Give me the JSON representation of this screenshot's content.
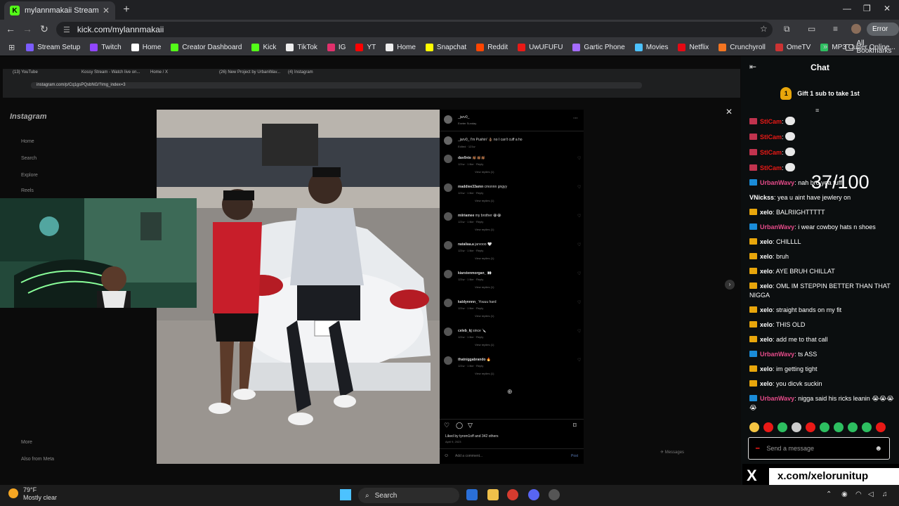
{
  "browser": {
    "tab_title": "mylannmakaii Stream - Watch l",
    "new_tab": "+",
    "url": "kick.com/mylannmakaii",
    "error_label": "Error",
    "bookmarks": [
      {
        "label": "Stream Setup",
        "color": "#7b5cff"
      },
      {
        "label": "Twitch",
        "color": "#9146ff"
      },
      {
        "label": "Home",
        "color": "#ffffff"
      },
      {
        "label": "Creator Dashboard",
        "color": "#53fc18"
      },
      {
        "label": "Kick",
        "color": "#53fc18"
      },
      {
        "label": "TikTok",
        "color": "#eeeeee"
      },
      {
        "label": "IG",
        "color": "#e1306c"
      },
      {
        "label": "YT",
        "color": "#ff0000"
      },
      {
        "label": "Home",
        "color": "#eeeeee"
      },
      {
        "label": "Snapchat",
        "color": "#fffc00"
      },
      {
        "label": "Reddit",
        "color": "#ff4500"
      },
      {
        "label": "UwUFUFU",
        "color": "#e91916"
      },
      {
        "label": "Gartic Phone",
        "color": "#a56cff"
      },
      {
        "label": "Movies",
        "color": "#4cc2ff"
      },
      {
        "label": "Netflix",
        "color": "#e50914"
      },
      {
        "label": "Crunchyroll",
        "color": "#f47521"
      },
      {
        "label": "OmeTV",
        "color": "#cc3333"
      },
      {
        "label": "MP3 Cutter Online...",
        "color": "#2dbe60"
      }
    ],
    "all_bookmarks": "All Bookmarks"
  },
  "stream": {
    "inner_tabs": [
      "(13) YouTube",
      "Kossy Stream - Watch live on...",
      "Home / X",
      "(26) New Project by UrbanWav...",
      "(4) Instagram"
    ],
    "inner_url": "instagram.com/p/Cq1gsPQsbNG/?img_index=3",
    "ig_logo": "Instagram",
    "ig_nav": [
      "Home",
      "Search",
      "Explore",
      "Reels",
      "More",
      "Also from Meta"
    ],
    "post": {
      "author": "_jarv0_",
      "location": "Exeter Sunday",
      "caption": "_jarv0_ I'm Pushin' 👌🏽 no I can't cuff a ho",
      "edited": "Edited · 121w",
      "comments": [
        {
          "user": "dav0nte",
          "text": "👏🏾👏🏾👏🏾"
        },
        {
          "user": "maddiee33amn",
          "text": "cmonnn gngyy"
        },
        {
          "user": "miiriamee",
          "text": "my brother 😭😭"
        },
        {
          "user": "nataliaa.a",
          "text": "jarvooo 🤍"
        },
        {
          "user": "kiarstenmorgan_",
          "text": "👀"
        },
        {
          "user": "kaldynnnn_",
          "text": "Youuu hard"
        },
        {
          "user": "celeb_kj",
          "text": "since 🔪"
        },
        {
          "user": "thatniggabrando",
          "text": "🔥"
        }
      ],
      "meta": "121w · 1 like · Reply",
      "view_replies": "View replies (1)",
      "liked_by": "Liked by tyrom1off and 342 others",
      "date": "April 9, 2023",
      "add_comment": "Add a comment...",
      "post_btn": "Post",
      "messages_label": "Messages"
    }
  },
  "chat": {
    "title": "Chat",
    "gift_badge": "1",
    "gift_text": "Gift 1 sub to take 1st",
    "counter": "37/100",
    "messages": [
      {
        "icon": "mod",
        "user": "StlCam",
        "user_class": "nm-red",
        "text": "",
        "bubble": true
      },
      {
        "icon": "mod",
        "user": "StlCam",
        "user_class": "nm-red",
        "text": "",
        "bubble": true
      },
      {
        "icon": "mod",
        "user": "StlCam",
        "user_class": "nm-red",
        "text": "",
        "bubble": true
      },
      {
        "icon": "mod",
        "user": "StlCam",
        "user_class": "nm-red",
        "text": "",
        "bubble": true
      },
      {
        "icon": "blue",
        "user": "UrbanWavy",
        "user_class": "nm-pink",
        "text": "nah bro yea tuff",
        "bubble": false
      },
      {
        "icon": "",
        "user": "VNickss",
        "user_class": "nm-white",
        "text": "yea u aint have jewlery on",
        "bubble": false
      },
      {
        "icon": "crown",
        "user": "xelo",
        "user_class": "nm-white",
        "text": "BALRIIGHTTTTT",
        "bubble": false
      },
      {
        "icon": "blue",
        "user": "UrbanWavy",
        "user_class": "nm-pink",
        "text": "i wear cowboy hats n shoes",
        "bubble": false
      },
      {
        "icon": "crown",
        "user": "xelo",
        "user_class": "nm-white",
        "text": "CHILLLL",
        "bubble": false
      },
      {
        "icon": "crown",
        "user": "xelo",
        "user_class": "nm-white",
        "text": "bruh",
        "bubble": false
      },
      {
        "icon": "crown",
        "user": "xelo",
        "user_class": "nm-white",
        "text": "AYE BRUH CHILLAT",
        "bubble": false
      },
      {
        "icon": "crown",
        "user": "xelo",
        "user_class": "nm-white",
        "text": "OML IM STEPPIN BETTER THAN THAT NIGGA",
        "bubble": false
      },
      {
        "icon": "crown",
        "user": "xelo",
        "user_class": "nm-white",
        "text": "straight bands on my fit",
        "bubble": false
      },
      {
        "icon": "crown",
        "user": "xelo",
        "user_class": "nm-white",
        "text": "THIS OLD",
        "bubble": false
      },
      {
        "icon": "crown",
        "user": "xelo",
        "user_class": "nm-white",
        "text": "add me to that call",
        "bubble": false
      },
      {
        "icon": "blue",
        "user": "UrbanWavy",
        "user_class": "nm-pink",
        "text": "ts ASS",
        "bubble": false
      },
      {
        "icon": "crown",
        "user": "xelo",
        "user_class": "nm-white",
        "text": "im getting tight",
        "bubble": false
      },
      {
        "icon": "crown",
        "user": "xelo",
        "user_class": "nm-white",
        "text": "you dicvk suckin",
        "bubble": false
      },
      {
        "icon": "blue",
        "user": "UrbanWavy",
        "user_class": "nm-pink",
        "text": "nigga said his ricks leanin 😭😭😭😭",
        "bubble": false
      }
    ],
    "emote_colors": [
      "#f5c542",
      "#e91916",
      "#2dbe60",
      "#cccccc",
      "#e91916",
      "#2dbe60",
      "#2dbe60",
      "#2dbe60",
      "#2dbe60",
      "#e91916"
    ],
    "send_placeholder": "Send a message"
  },
  "overlay": {
    "x_logo": "X",
    "x_handle": "x.com/xelorunitup"
  },
  "taskbar": {
    "temp": "79°F",
    "weather": "Mostly clear",
    "search": "Search"
  }
}
